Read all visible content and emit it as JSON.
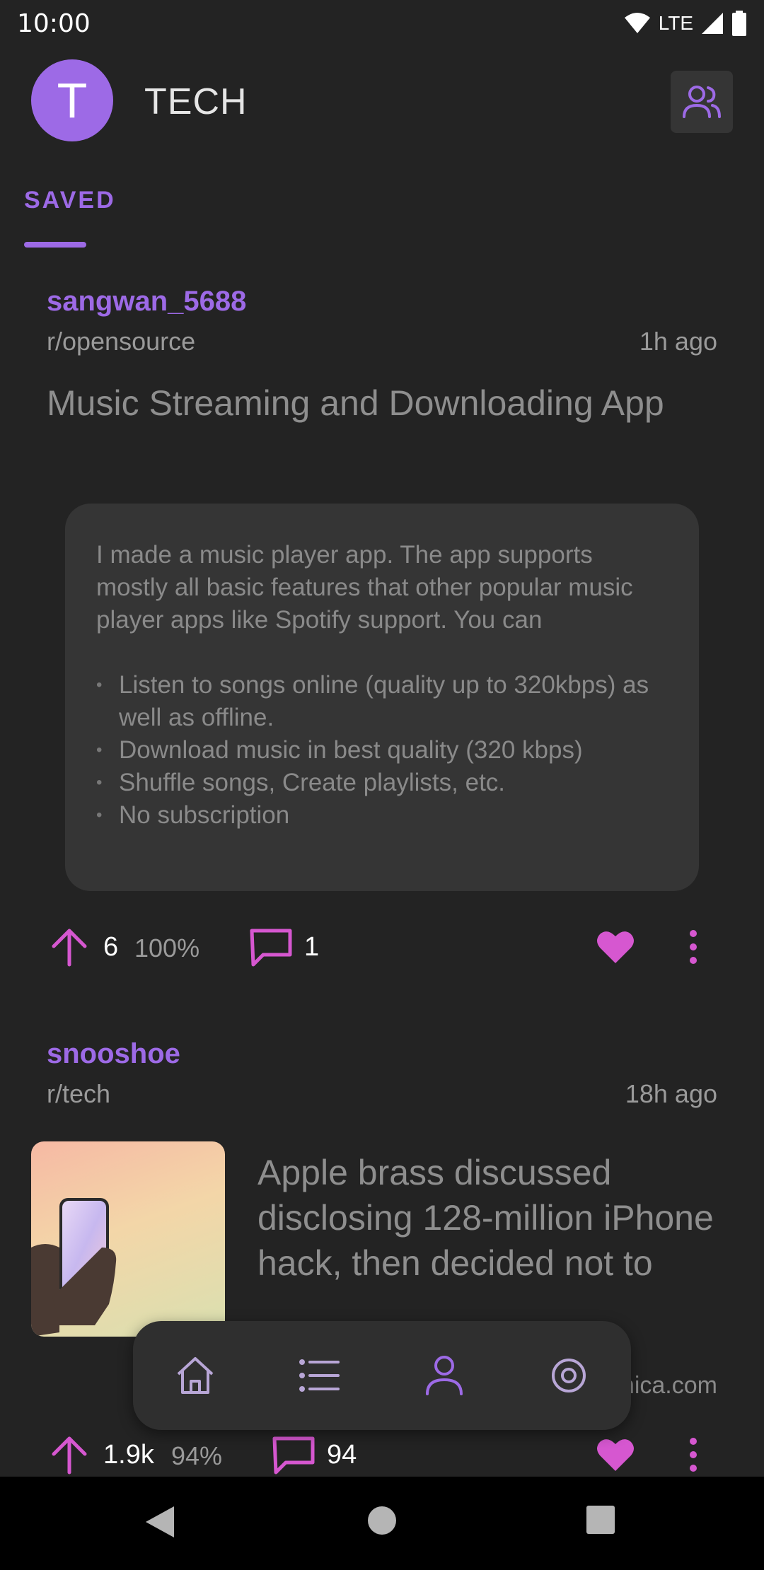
{
  "status_bar": {
    "time": "10:00",
    "network": "LTE"
  },
  "header": {
    "avatar_letter": "T",
    "title": "TECH"
  },
  "tabs": [
    {
      "label": "SAVED",
      "active": true
    }
  ],
  "posts": [
    {
      "author": "sangwan_5688",
      "subreddit": "r/opensource",
      "time": "1h ago",
      "title": "Music Streaming and Downloading App",
      "selftext": {
        "paragraph": "I made a music player app. The app supports mostly all basic features that other popular music player apps like Spotify support. You can",
        "bullets": [
          "Listen to songs online (quality up to 320kbps) as well as offline.",
          "Download music in best quality (320 kbps)",
          "Shuffle songs, Create playlists, etc.",
          "No subscription"
        ]
      },
      "score": "6",
      "upvote_ratio": "100%",
      "comments": "1",
      "saved": true
    },
    {
      "author": "snooshoe",
      "subreddit": "r/tech",
      "time": "18h ago",
      "title": "Apple brass discussed disclosing 128-million iPhone hack, then decided not to",
      "domain_visible": "nica.com",
      "score": "1.9k",
      "upvote_ratio": "94%",
      "comments": "94",
      "saved": true
    }
  ],
  "bottom_nav": {
    "items": [
      "home-icon",
      "list-icon",
      "profile-icon",
      "settings-icon"
    ],
    "active": "profile-icon"
  },
  "colors": {
    "accent": "#9d6ae6",
    "pink": "#d657d0",
    "background": "#232323",
    "card": "#353535"
  }
}
